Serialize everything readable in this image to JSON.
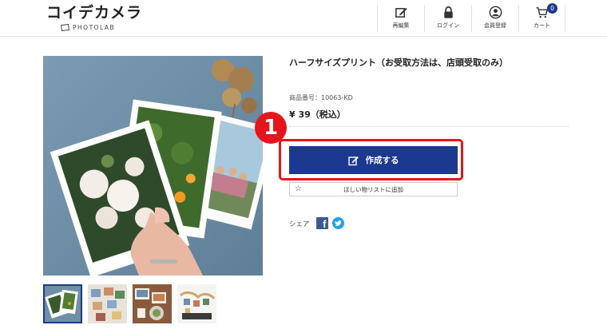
{
  "header": {
    "logo_text": "コイデカメラ",
    "logo_sub": "PHOTOLAB",
    "nav": [
      {
        "label": "再編集",
        "icon": "edit-icon"
      },
      {
        "label": "ログイン",
        "icon": "lock-icon"
      },
      {
        "label": "会員登録",
        "icon": "user-icon"
      },
      {
        "label": "カート",
        "icon": "cart-icon",
        "badge": "0"
      }
    ]
  },
  "product": {
    "title": "ハーフサイズプリント（お受取方法は、店頭受取のみ）",
    "sku": "商品番号：10063-KD",
    "price": "¥ 39（税込）",
    "create_label": "作成する",
    "wishlist_label": "ほしい物リストに追加",
    "share_label": "シェア"
  },
  "annotation": {
    "step": "1",
    "color": "#e8141c"
  },
  "colors": {
    "brand": "#1b3a8f",
    "facebook": "#3b5998",
    "twitter": "#1da1f2"
  }
}
